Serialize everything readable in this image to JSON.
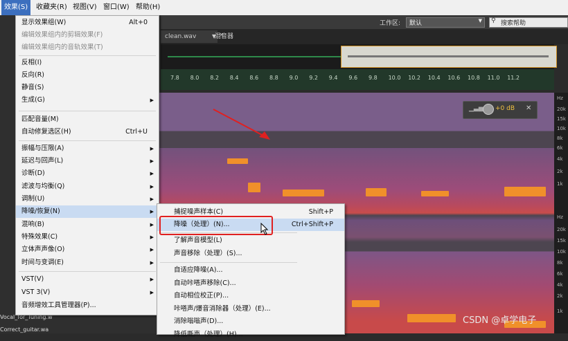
{
  "menubar": {
    "items": [
      "效果(S)",
      "收藏夹(R)",
      "视图(V)",
      "窗口(W)",
      "帮助(H)"
    ]
  },
  "toolbar": {
    "workspace_label": "工作区:",
    "workspace_value": "默认",
    "search_placeholder": "搜索帮助"
  },
  "tabs": {
    "file": "clean.wav",
    "mixer": "混音器"
  },
  "ruler": {
    "ticks": [
      "7.8",
      "8.0",
      "8.2",
      "8.4",
      "8.6",
      "8.8",
      "9.0",
      "9.2",
      "9.4",
      "9.6",
      "9.8",
      "10.0",
      "10.2",
      "10.4",
      "10.6",
      "10.8",
      "11.0",
      "11.2"
    ]
  },
  "volume": {
    "value": "+0 dB"
  },
  "hz_scale": [
    "Hz",
    "20k",
    "15k",
    "10k",
    "8k",
    "6k",
    "4k",
    "2k",
    "1k",
    "Hz",
    "20k",
    "15k",
    "10k",
    "8k",
    "6k",
    "4k",
    "2k",
    "1k"
  ],
  "left_files": [
    "Vocal_for_Tuning.w",
    "Correct_guitar.wa"
  ],
  "menu": {
    "items": [
      {
        "label": "显示效果组(W)",
        "shortcut": "Alt+0",
        "disabled": false
      },
      {
        "label": "编辑效果组内的剪辑效果(F)",
        "shortcut": "",
        "disabled": true
      },
      {
        "label": "编辑效果组内的音轨效果(T)",
        "shortcut": "",
        "disabled": true
      },
      {
        "label": "反相(I)",
        "shortcut": "",
        "disabled": false
      },
      {
        "label": "反向(R)",
        "shortcut": "",
        "disabled": false
      },
      {
        "label": "静音(S)",
        "shortcut": "",
        "disabled": false
      },
      {
        "label": "生成(G)",
        "shortcut": "",
        "disabled": false,
        "submenu": true
      },
      {
        "label": "匹配音量(M)",
        "shortcut": "",
        "disabled": false
      },
      {
        "label": "自动修复选区(H)",
        "shortcut": "Ctrl+U",
        "disabled": false
      },
      {
        "label": "振幅与压限(A)",
        "shortcut": "",
        "disabled": false,
        "submenu": true
      },
      {
        "label": "延迟与回声(L)",
        "shortcut": "",
        "disabled": false,
        "submenu": true
      },
      {
        "label": "诊断(D)",
        "shortcut": "",
        "disabled": false,
        "submenu": true
      },
      {
        "label": "滤波与均衡(Q)",
        "shortcut": "",
        "disabled": false,
        "submenu": true
      },
      {
        "label": "调制(U)",
        "shortcut": "",
        "disabled": false,
        "submenu": true
      },
      {
        "label": "降噪/恢复(N)",
        "shortcut": "",
        "disabled": false,
        "submenu": true,
        "selected": true
      },
      {
        "label": "混响(B)",
        "shortcut": "",
        "disabled": false,
        "submenu": true
      },
      {
        "label": "特殊效果(C)",
        "shortcut": "",
        "disabled": false,
        "submenu": true
      },
      {
        "label": "立体声声像(O)",
        "shortcut": "",
        "disabled": false,
        "submenu": true
      },
      {
        "label": "时间与变调(E)",
        "shortcut": "",
        "disabled": false,
        "submenu": true
      },
      {
        "label": "VST(V)",
        "shortcut": "",
        "disabled": false,
        "submenu": true
      },
      {
        "label": "VST 3(V)",
        "shortcut": "",
        "disabled": false,
        "submenu": true
      },
      {
        "label": "音频增效工具管理器(P)...",
        "shortcut": "",
        "disabled": false
      }
    ]
  },
  "submenu": {
    "items": [
      {
        "label": "捕捉噪声样本(C)",
        "shortcut": "Shift+P"
      },
      {
        "label": "降噪（处理）(N)...",
        "shortcut": "Ctrl+Shift+P",
        "selected": true
      },
      {
        "label": "了解声音模型(L)",
        "shortcut": ""
      },
      {
        "label": "声音移除（处理）(S)...",
        "shortcut": ""
      },
      {
        "label": "自适应降噪(A)...",
        "shortcut": ""
      },
      {
        "label": "自动咔嗒声移除(C)...",
        "shortcut": ""
      },
      {
        "label": "自动相位校正(P)...",
        "shortcut": ""
      },
      {
        "label": "咔嗒声/爆音消除器（处理）(E)...",
        "shortcut": ""
      },
      {
        "label": "消除嗡嗡声(D)...",
        "shortcut": ""
      },
      {
        "label": "降低嘶声（处理）(H)...",
        "shortcut": ""
      }
    ]
  },
  "watermark": "CSDN @卓学电子",
  "colors": {
    "menu_active": "#3c6fbe",
    "highlight_border": "#e02020",
    "ruler_bg": "#22382a"
  }
}
